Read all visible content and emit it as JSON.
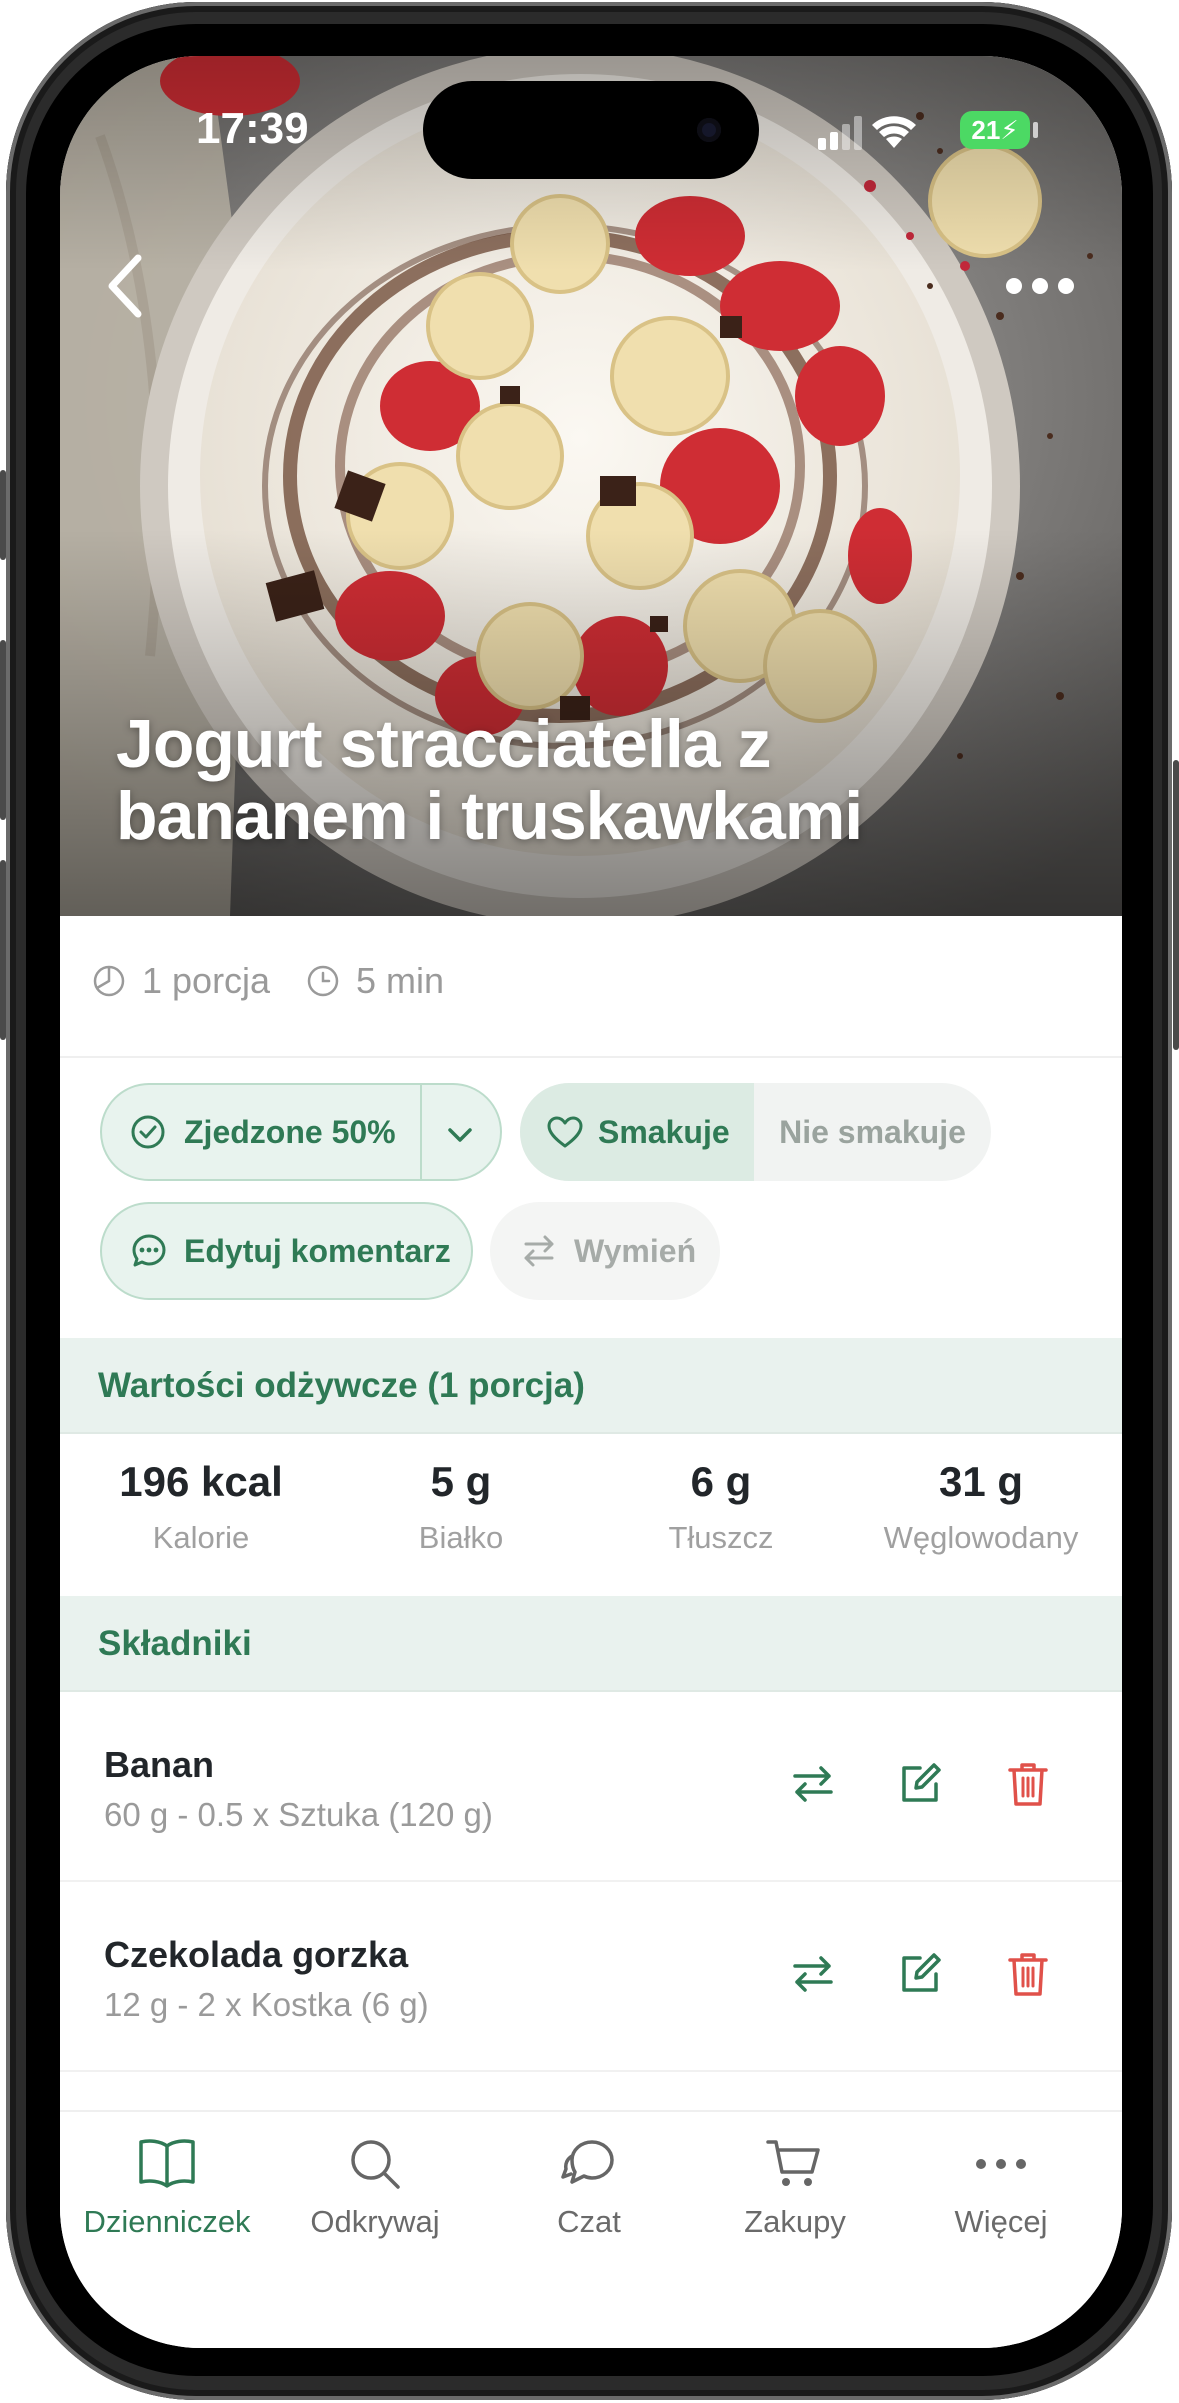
{
  "status_bar": {
    "time": "17:39",
    "battery": "21"
  },
  "hero": {
    "title": "Jogurt stracciatella z bananem i truskawkami"
  },
  "meta": {
    "portions": "1 porcja",
    "time": "5 min"
  },
  "actions": {
    "eaten_label": "Zjedzone 50%",
    "like_label": "Smakuje",
    "dislike_label": "Nie smakuje",
    "comment_label": "Edytuj komentarz",
    "swap_label": "Wymień"
  },
  "nutrition": {
    "header": "Wartości odżywcze (1 porcja)",
    "items": [
      {
        "value": "196 kcal",
        "label": "Kalorie"
      },
      {
        "value": "5 g",
        "label": "Białko"
      },
      {
        "value": "6 g",
        "label": "Tłuszcz"
      },
      {
        "value": "31 g",
        "label": "Węglowodany"
      }
    ]
  },
  "ingredients": {
    "header": "Składniki",
    "items": [
      {
        "name": "Banan",
        "amount": "60 g - 0.5 x Sztuka (120 g)"
      },
      {
        "name": "Czekolada gorzka",
        "amount": "12 g - 2 x Kostka (6 g)"
      }
    ]
  },
  "tabbar": {
    "items": [
      {
        "label": "Dzienniczek",
        "icon": "book-icon"
      },
      {
        "label": "Odkrywaj",
        "icon": "search-icon"
      },
      {
        "label": "Czat",
        "icon": "chat-icon"
      },
      {
        "label": "Zakupy",
        "icon": "cart-icon"
      },
      {
        "label": "Więcej",
        "icon": "more-icon"
      }
    ]
  },
  "colors": {
    "accent": "#2f7a55",
    "delete": "#e0514a",
    "section_bg": "#e9f2ee"
  }
}
